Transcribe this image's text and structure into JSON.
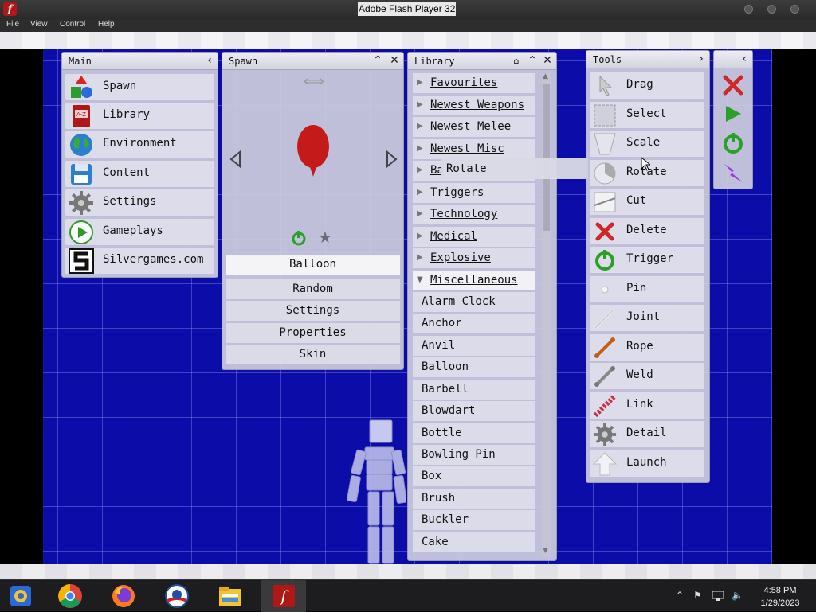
{
  "window": {
    "title": "Adobe Flash Player 32",
    "app_icon_glyph": "f",
    "menu": [
      "File",
      "View",
      "Control",
      "Help"
    ]
  },
  "main_panel": {
    "title": "Main",
    "items": [
      {
        "label": "Spawn",
        "icon": "shapes-icon"
      },
      {
        "label": "Library",
        "icon": "book-icon"
      },
      {
        "label": "Environment",
        "icon": "globe-icon"
      },
      {
        "label": "Content",
        "icon": "disk-icon"
      },
      {
        "label": "Settings",
        "icon": "gear-icon"
      },
      {
        "label": "Gameplays",
        "icon": "play-icon"
      },
      {
        "label": "Silvergames.com",
        "icon": "silvergames-logo-icon"
      }
    ]
  },
  "spawn_panel": {
    "title": "Spawn",
    "selected": "Balloon",
    "options": [
      "Random",
      "Settings",
      "Properties",
      "Skin"
    ],
    "colors": {
      "balloon": "#c41a1a",
      "trigger": "#2f9e2f",
      "star": "#6c6c74"
    }
  },
  "library_panel": {
    "title": "Library",
    "categories": [
      "Favourites",
      "Newest Weapons",
      "Newest Melee",
      "Newest Misc",
      "Ba",
      "Triggers",
      "Technology",
      "Medical",
      "Explosive",
      "Miscellaneous"
    ],
    "items": [
      "Alarm Clock",
      "Anchor",
      "Anvil",
      "Balloon",
      "Barbell",
      "Blowdart",
      "Bottle",
      "Bowling Pin",
      "Box",
      "Brush",
      "Buckler",
      "Cake"
    ],
    "tooltip": "Rotate"
  },
  "tools_panel": {
    "title": "Tools",
    "tools": [
      {
        "label": "Drag",
        "icon": "cursor-icon"
      },
      {
        "label": "Select",
        "icon": "select-box-icon"
      },
      {
        "label": "Scale",
        "icon": "scale-icon"
      },
      {
        "label": "Rotate",
        "icon": "rotate-icon"
      },
      {
        "label": "Cut",
        "icon": "cut-icon"
      },
      {
        "label": "Delete",
        "icon": "delete-x-icon"
      },
      {
        "label": "Trigger",
        "icon": "power-icon"
      },
      {
        "label": "Pin",
        "icon": "pin-icon"
      },
      {
        "label": "Joint",
        "icon": "joint-icon"
      },
      {
        "label": "Rope",
        "icon": "rope-icon"
      },
      {
        "label": "Weld",
        "icon": "weld-icon"
      },
      {
        "label": "Link",
        "icon": "link-icon"
      },
      {
        "label": "Detail",
        "icon": "gear-icon"
      },
      {
        "label": "Launch",
        "icon": "arrow-up-icon"
      }
    ]
  },
  "quick_panel": {
    "buttons": [
      {
        "name": "clear-x-icon",
        "color": "#d02828"
      },
      {
        "name": "play-icon",
        "color": "#2aa02a"
      },
      {
        "name": "power-icon",
        "color": "#2aa02a"
      },
      {
        "name": "lightning-icon",
        "color": "#9a3ce0"
      }
    ]
  },
  "taskbar": {
    "apps": [
      "ie-icon",
      "chrome-icon",
      "firefox-icon",
      "obama-logo-icon",
      "file-explorer-icon",
      "flash-icon"
    ],
    "time": "4:58 PM",
    "date": "1/29/2023"
  },
  "colors": {
    "stage": "#0c0ca8",
    "panel": "#cdcdde",
    "taskbar": "#1d1d1f"
  }
}
